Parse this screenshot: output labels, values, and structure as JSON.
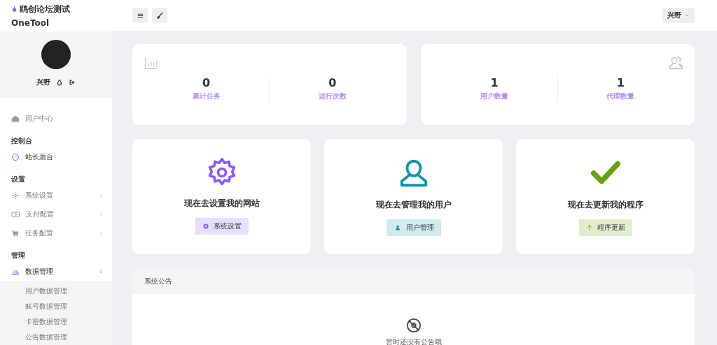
{
  "sidebar": {
    "brand": "鸥创论坛测试",
    "subtitle": "OneTool",
    "user": {
      "name": "兴野"
    },
    "nav": [
      {
        "kind": "link",
        "label": "用户中心",
        "selected": false
      },
      {
        "kind": "heading",
        "label": "控制台"
      },
      {
        "kind": "link",
        "label": "站长后台",
        "selected": true
      },
      {
        "kind": "heading",
        "label": "设置"
      },
      {
        "kind": "menu",
        "label": "系统设置",
        "expanded": false
      },
      {
        "kind": "menu",
        "label": "支付配置",
        "expanded": false
      },
      {
        "kind": "menu",
        "label": "任务配置",
        "expanded": false
      },
      {
        "kind": "heading",
        "label": "管理"
      },
      {
        "kind": "menu",
        "label": "数据管理",
        "expanded": true,
        "children": [
          {
            "label": "用户数据管理"
          },
          {
            "label": "账号数据管理"
          },
          {
            "label": "卡密数据管理"
          },
          {
            "label": "公告数据管理"
          }
        ]
      }
    ]
  },
  "header": {
    "user": "兴野"
  },
  "stat_cards": [
    {
      "stats": [
        {
          "value": "0",
          "label": "累计任务"
        },
        {
          "value": "0",
          "label": "运行次数"
        }
      ]
    },
    {
      "stats": [
        {
          "value": "1",
          "label": "用户数量"
        },
        {
          "value": "1",
          "label": "代理数量"
        }
      ]
    }
  ],
  "action_cards": [
    {
      "title": "现在去设置我的网站",
      "button": "系统设置",
      "color": "#8b5cf6"
    },
    {
      "title": "现在去管理我的用户",
      "button": "用户管理",
      "color": "#1594aa"
    },
    {
      "title": "现在去更新我的程序",
      "button": "程序更新",
      "color": "#65a30d"
    }
  ],
  "announcement": {
    "title": "系统公告",
    "empty_text": "暂时还没有公告哦"
  }
}
